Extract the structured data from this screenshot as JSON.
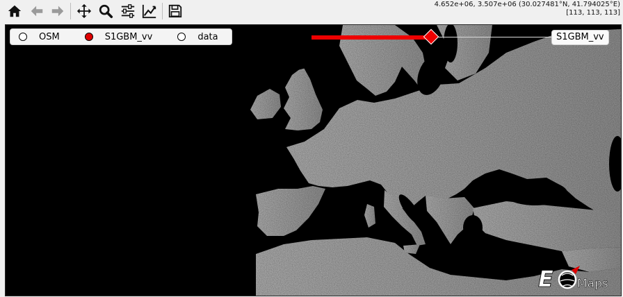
{
  "toolbar": {
    "buttons": [
      {
        "name": "home-icon",
        "tip": "Reset original view"
      },
      {
        "name": "back-arrow-icon",
        "tip": "Back"
      },
      {
        "name": "forward-arrow-icon",
        "tip": "Forward"
      },
      {
        "name": "pan-icon",
        "tip": "Pan"
      },
      {
        "name": "zoom-icon",
        "tip": "Zoom"
      },
      {
        "name": "subplots-config-icon",
        "tip": "Configure subplots"
      },
      {
        "name": "edit-axes-icon",
        "tip": "Edit axis"
      },
      {
        "name": "save-icon",
        "tip": "Save"
      }
    ],
    "coords_line1": "4.652e+06, 3.507e+06 (30.027481°N, 41.794025°E)",
    "coords_line2": "[113, 113, 113]"
  },
  "layers": {
    "items": [
      {
        "label": "OSM",
        "selected": false
      },
      {
        "label": "S1GBM_vv",
        "selected": true
      },
      {
        "label": "data",
        "selected": false
      }
    ]
  },
  "slider": {
    "label": "S1GBM_vv",
    "value_fraction": 0.5,
    "color": "#ee0000"
  },
  "logo": {
    "text": "Maps",
    "mark": "EO"
  },
  "colors": {
    "map_background": "#000000",
    "land": "#9a9a9a",
    "accent": "#e00000"
  }
}
